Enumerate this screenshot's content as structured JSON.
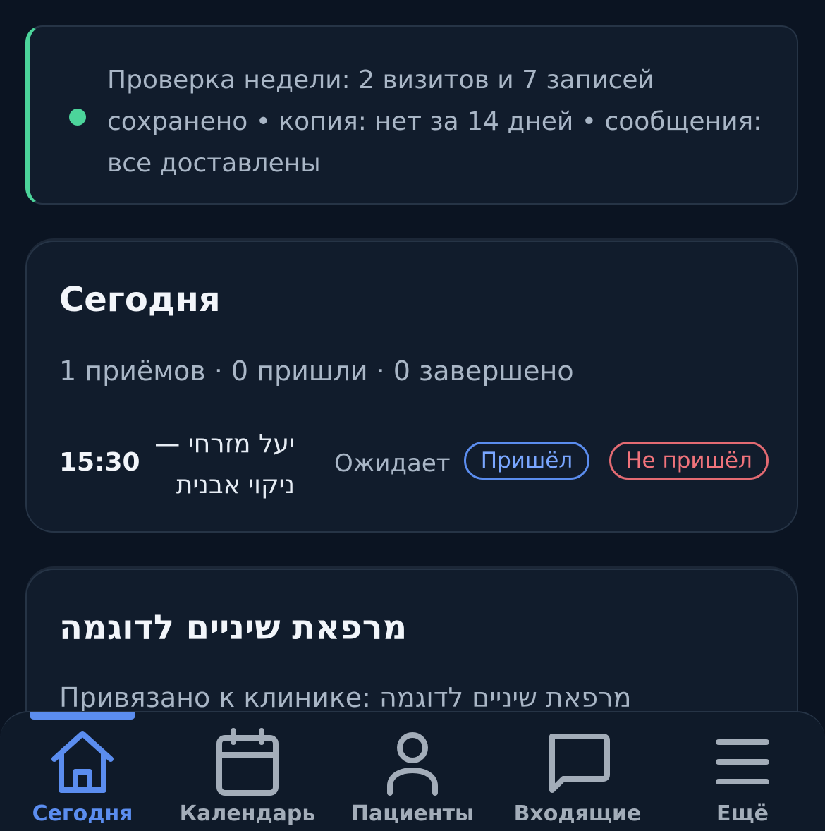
{
  "banner": {
    "text": "Проверка недели: 2 визитов и 7 записей сохранено • копия: нет за 14 дней • сообщения: все доставлены",
    "status_color": "#4cd49b"
  },
  "today_card": {
    "title": "Сегодня",
    "summary": "1 приёмов · 0 пришли · 0 завершено",
    "appointment": {
      "time": "15:30",
      "patient_and_service": "יעל מזרחי — ניקוי אבנית",
      "status": "Ожидает",
      "came_label": "Пришёл",
      "no_show_label": "Не пришёл"
    }
  },
  "clinic_card": {
    "title": "מרפאת שיניים לדוגמה",
    "subtitle": "Привязано к клинике: מרפאת שיניים לדוגמה"
  },
  "bottom_nav": {
    "accent_color": "#5b8def",
    "items": [
      {
        "label": "Сегодня",
        "icon": "home-icon",
        "active": true
      },
      {
        "label": "Календарь",
        "icon": "calendar-icon",
        "active": false
      },
      {
        "label": "Пациенты",
        "icon": "user-icon",
        "active": false
      },
      {
        "label": "Входящие",
        "icon": "message-icon",
        "active": false
      },
      {
        "label": "Ещё",
        "icon": "menu-icon",
        "active": false
      }
    ]
  }
}
